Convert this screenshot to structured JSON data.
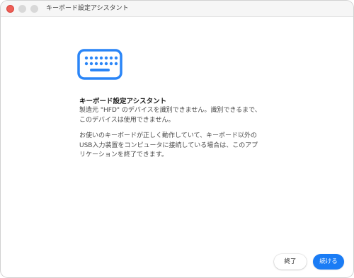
{
  "window": {
    "title": "キーボード設定アシスタント"
  },
  "content": {
    "icon": "keyboard-icon",
    "heading": "キーボード設定アシスタント",
    "paragraph1": [
      "製造元 \"HFD\" のデバイスを識別できません。識別できるまで、",
      "このデバイスは使用できません。"
    ],
    "paragraph2": [
      "お使いのキーボードが正しく動作していて、キーボード以外の",
      "USB入力装置をコンピュータに接続している場合は、このアプ",
      "リケーションを終了できます。"
    ]
  },
  "buttons": {
    "quit_label": "終了",
    "continue_label": "続ける"
  },
  "colors": {
    "accent": "#1a7cf5",
    "close_button": "#ee5e56"
  }
}
